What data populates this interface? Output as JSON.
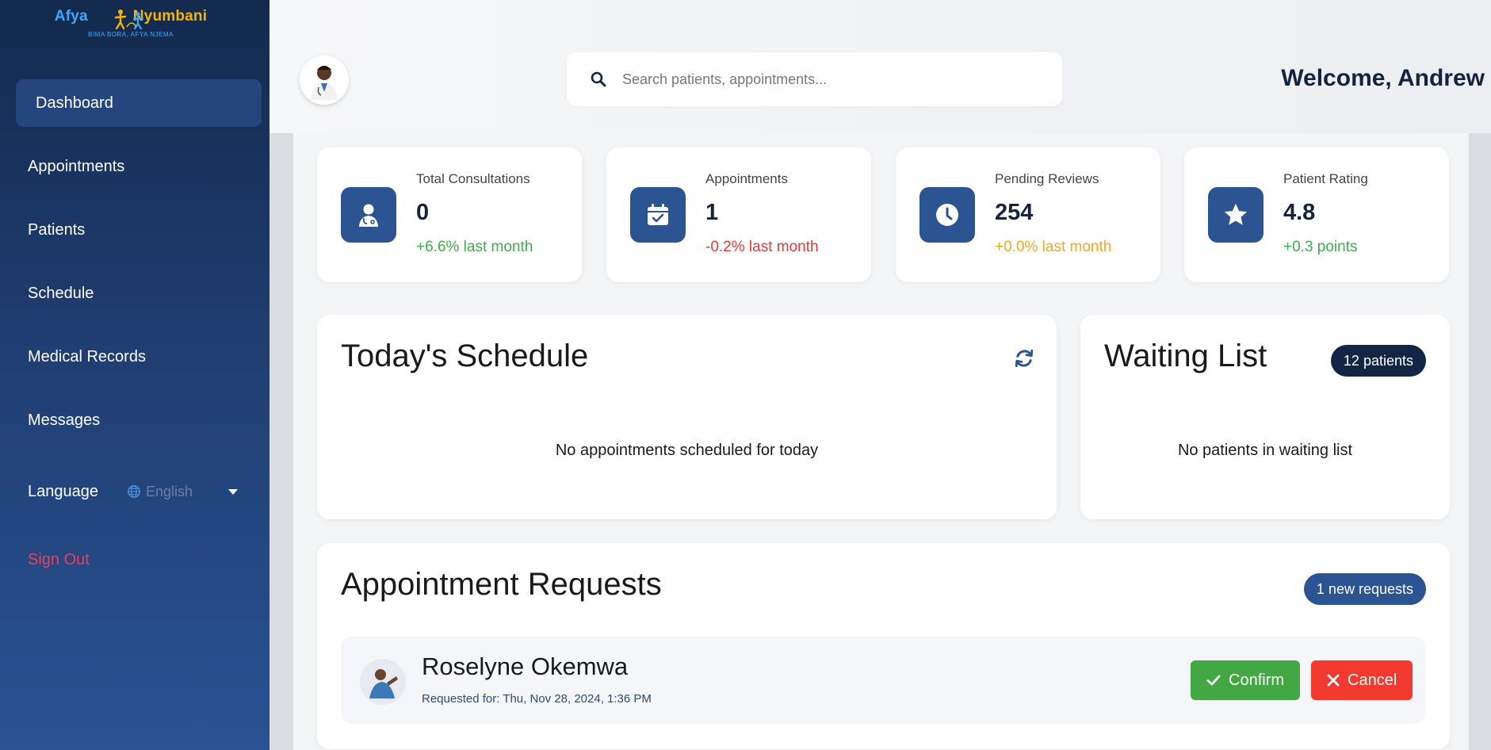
{
  "app": {
    "logo_text_1": "Afya",
    "logo_text_2": "Nyumbani",
    "logo_tagline": "BIMA BORA, AFYA NJEMA"
  },
  "sidebar": {
    "items": [
      {
        "label": "Dashboard",
        "active": true
      },
      {
        "label": "Appointments"
      },
      {
        "label": "Patients"
      },
      {
        "label": "Schedule"
      },
      {
        "label": "Medical Records"
      },
      {
        "label": "Messages"
      }
    ],
    "language_label": "Language",
    "language_value": "English",
    "signout_label": "Sign Out"
  },
  "header": {
    "search_placeholder": "Search patients, appointments...",
    "welcome": "Welcome, Andrew"
  },
  "stats": [
    {
      "label": "Total Consultations",
      "value": "0",
      "change": "+6.6% last month",
      "tone": "green",
      "icon": "doctor-icon"
    },
    {
      "label": "Appointments",
      "value": "1",
      "change": "-0.2% last month",
      "tone": "red",
      "icon": "calendar-check-icon"
    },
    {
      "label": "Pending Reviews",
      "value": "254",
      "change": "+0.0% last month",
      "tone": "orange",
      "icon": "clock-icon"
    },
    {
      "label": "Patient Rating",
      "value": "4.8",
      "change": "+0.3 points",
      "tone": "green",
      "icon": "star-icon"
    }
  ],
  "schedule": {
    "title": "Today's Schedule",
    "empty": "No appointments scheduled for today"
  },
  "waiting": {
    "title": "Waiting List",
    "badge": "12 patients",
    "empty": "No patients in waiting list"
  },
  "requests": {
    "title": "Appointment Requests",
    "badge": "1 new requests",
    "items": [
      {
        "name": "Roselyne Okemwa",
        "requested": "Requested for: Thu, Nov 28, 2024, 1:36 PM",
        "confirm_label": "Confirm",
        "cancel_label": "Cancel"
      }
    ]
  },
  "colors": {
    "accent": "#2c5392",
    "success": "#43a843",
    "danger": "#f23a30",
    "dark_badge": "#132544",
    "signout": "#e8405b"
  }
}
